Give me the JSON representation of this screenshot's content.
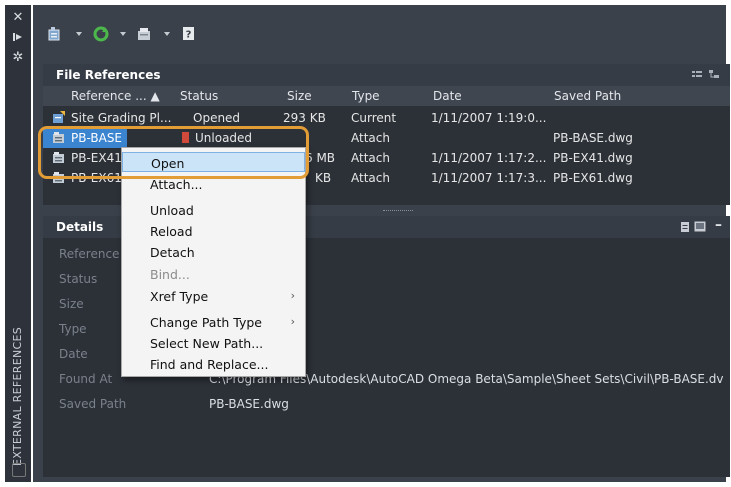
{
  "palette": {
    "accent": "#3a84d0",
    "callout": "#e39d36",
    "panel": "#2c3138"
  },
  "sidebar": {
    "title": "EXTERNAL REFERENCES",
    "icons": [
      "close-icon",
      "autohide-icon",
      "settings-icon"
    ]
  },
  "toolbar": {
    "icons": [
      "attach-dwg-icon",
      "refresh-icon",
      "change-path-icon",
      "help-icon"
    ]
  },
  "file_references": {
    "title": "File References",
    "columns": [
      "Reference ...",
      "Status",
      "Size",
      "Type",
      "Date",
      "Saved Path"
    ],
    "rows": [
      {
        "name": "Site Grading Pl...",
        "status": "Opened",
        "size": "293 KB",
        "type": "Current",
        "date": "1/11/2007 1:19:0...",
        "path": ""
      },
      {
        "name": "PB-BASE",
        "status": "Unloaded",
        "size": "",
        "type": "Attach",
        "date": "",
        "path": "PB-BASE.dwg"
      },
      {
        "name": "PB-EX41",
        "status": "",
        "size": "6 MB",
        "type": "Attach",
        "date": "1/11/2007 1:17:2...",
        "path": "PB-EX41.dwg"
      },
      {
        "name": "PB-EX61",
        "status": "",
        "size": "KB",
        "type": "Attach",
        "date": "1/11/2007 1:17:3...",
        "path": "PB-EX61.dwg"
      }
    ]
  },
  "details": {
    "title": "Details",
    "labels": [
      "Reference N",
      "Status",
      "Size",
      "Type",
      "Date",
      "Found At",
      "Saved Path"
    ],
    "found_at": "C:\\Program Files\\Autodesk\\AutoCAD Omega Beta\\Sample\\Sheet Sets\\Civil\\PB-BASE.dv",
    "saved_path": "PB-BASE.dwg"
  },
  "context_menu": {
    "items": [
      {
        "label": "Open"
      },
      {
        "label": "Attach..."
      },
      {
        "label": "Unload"
      },
      {
        "label": "Reload"
      },
      {
        "label": "Detach"
      },
      {
        "label": "Bind..."
      },
      {
        "label": "Xref Type"
      },
      {
        "label": "Change Path Type"
      },
      {
        "label": "Select New Path..."
      },
      {
        "label": "Find and Replace..."
      }
    ]
  }
}
